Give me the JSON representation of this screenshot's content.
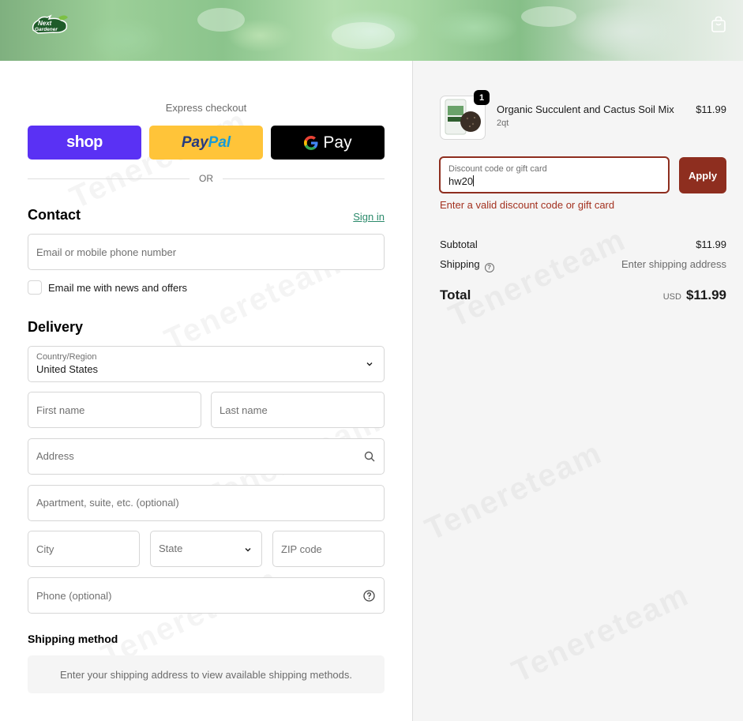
{
  "header": {
    "logo_text": "Next Gardener",
    "cart_icon": "shopping-bag-icon"
  },
  "express": {
    "label": "Express checkout",
    "shop_label": "shop",
    "paypal_label_a": "Pay",
    "paypal_label_b": "Pal",
    "gpay_label": "Pay",
    "or_label": "OR"
  },
  "contact": {
    "heading": "Contact",
    "sign_in": "Sign in",
    "email_placeholder": "Email or mobile phone number",
    "newsletter_label": "Email me with news and offers"
  },
  "delivery": {
    "heading": "Delivery",
    "country_label": "Country/Region",
    "country_value": "United States",
    "first_name": "First name",
    "last_name": "Last name",
    "address": "Address",
    "apartment": "Apartment, suite, etc. (optional)",
    "city": "City",
    "state": "State",
    "zip": "ZIP code",
    "phone": "Phone (optional)"
  },
  "shipping_method": {
    "heading": "Shipping method",
    "message": "Enter your shipping address to view available shipping methods."
  },
  "order": {
    "quantity": "1",
    "product_name": "Organic Succulent and Cactus Soil Mix",
    "variant": "2qt",
    "price": "$11.99"
  },
  "discount": {
    "label": "Discount code or gift card",
    "value": "hw20",
    "apply": "Apply",
    "error": "Enter a valid discount code or gift card"
  },
  "summary": {
    "subtotal_label": "Subtotal",
    "subtotal_value": "$11.99",
    "shipping_label": "Shipping",
    "shipping_help": "?",
    "shipping_value": "Enter shipping address",
    "total_label": "Total",
    "currency": "USD",
    "total_value": "$11.99"
  },
  "watermark": "Tenereteam",
  "colors": {
    "shop": "#5a31f4",
    "paypal": "#ffc439",
    "apply": "#8e2e1f",
    "error": "#a3311f",
    "link": "#2b8a6b"
  }
}
